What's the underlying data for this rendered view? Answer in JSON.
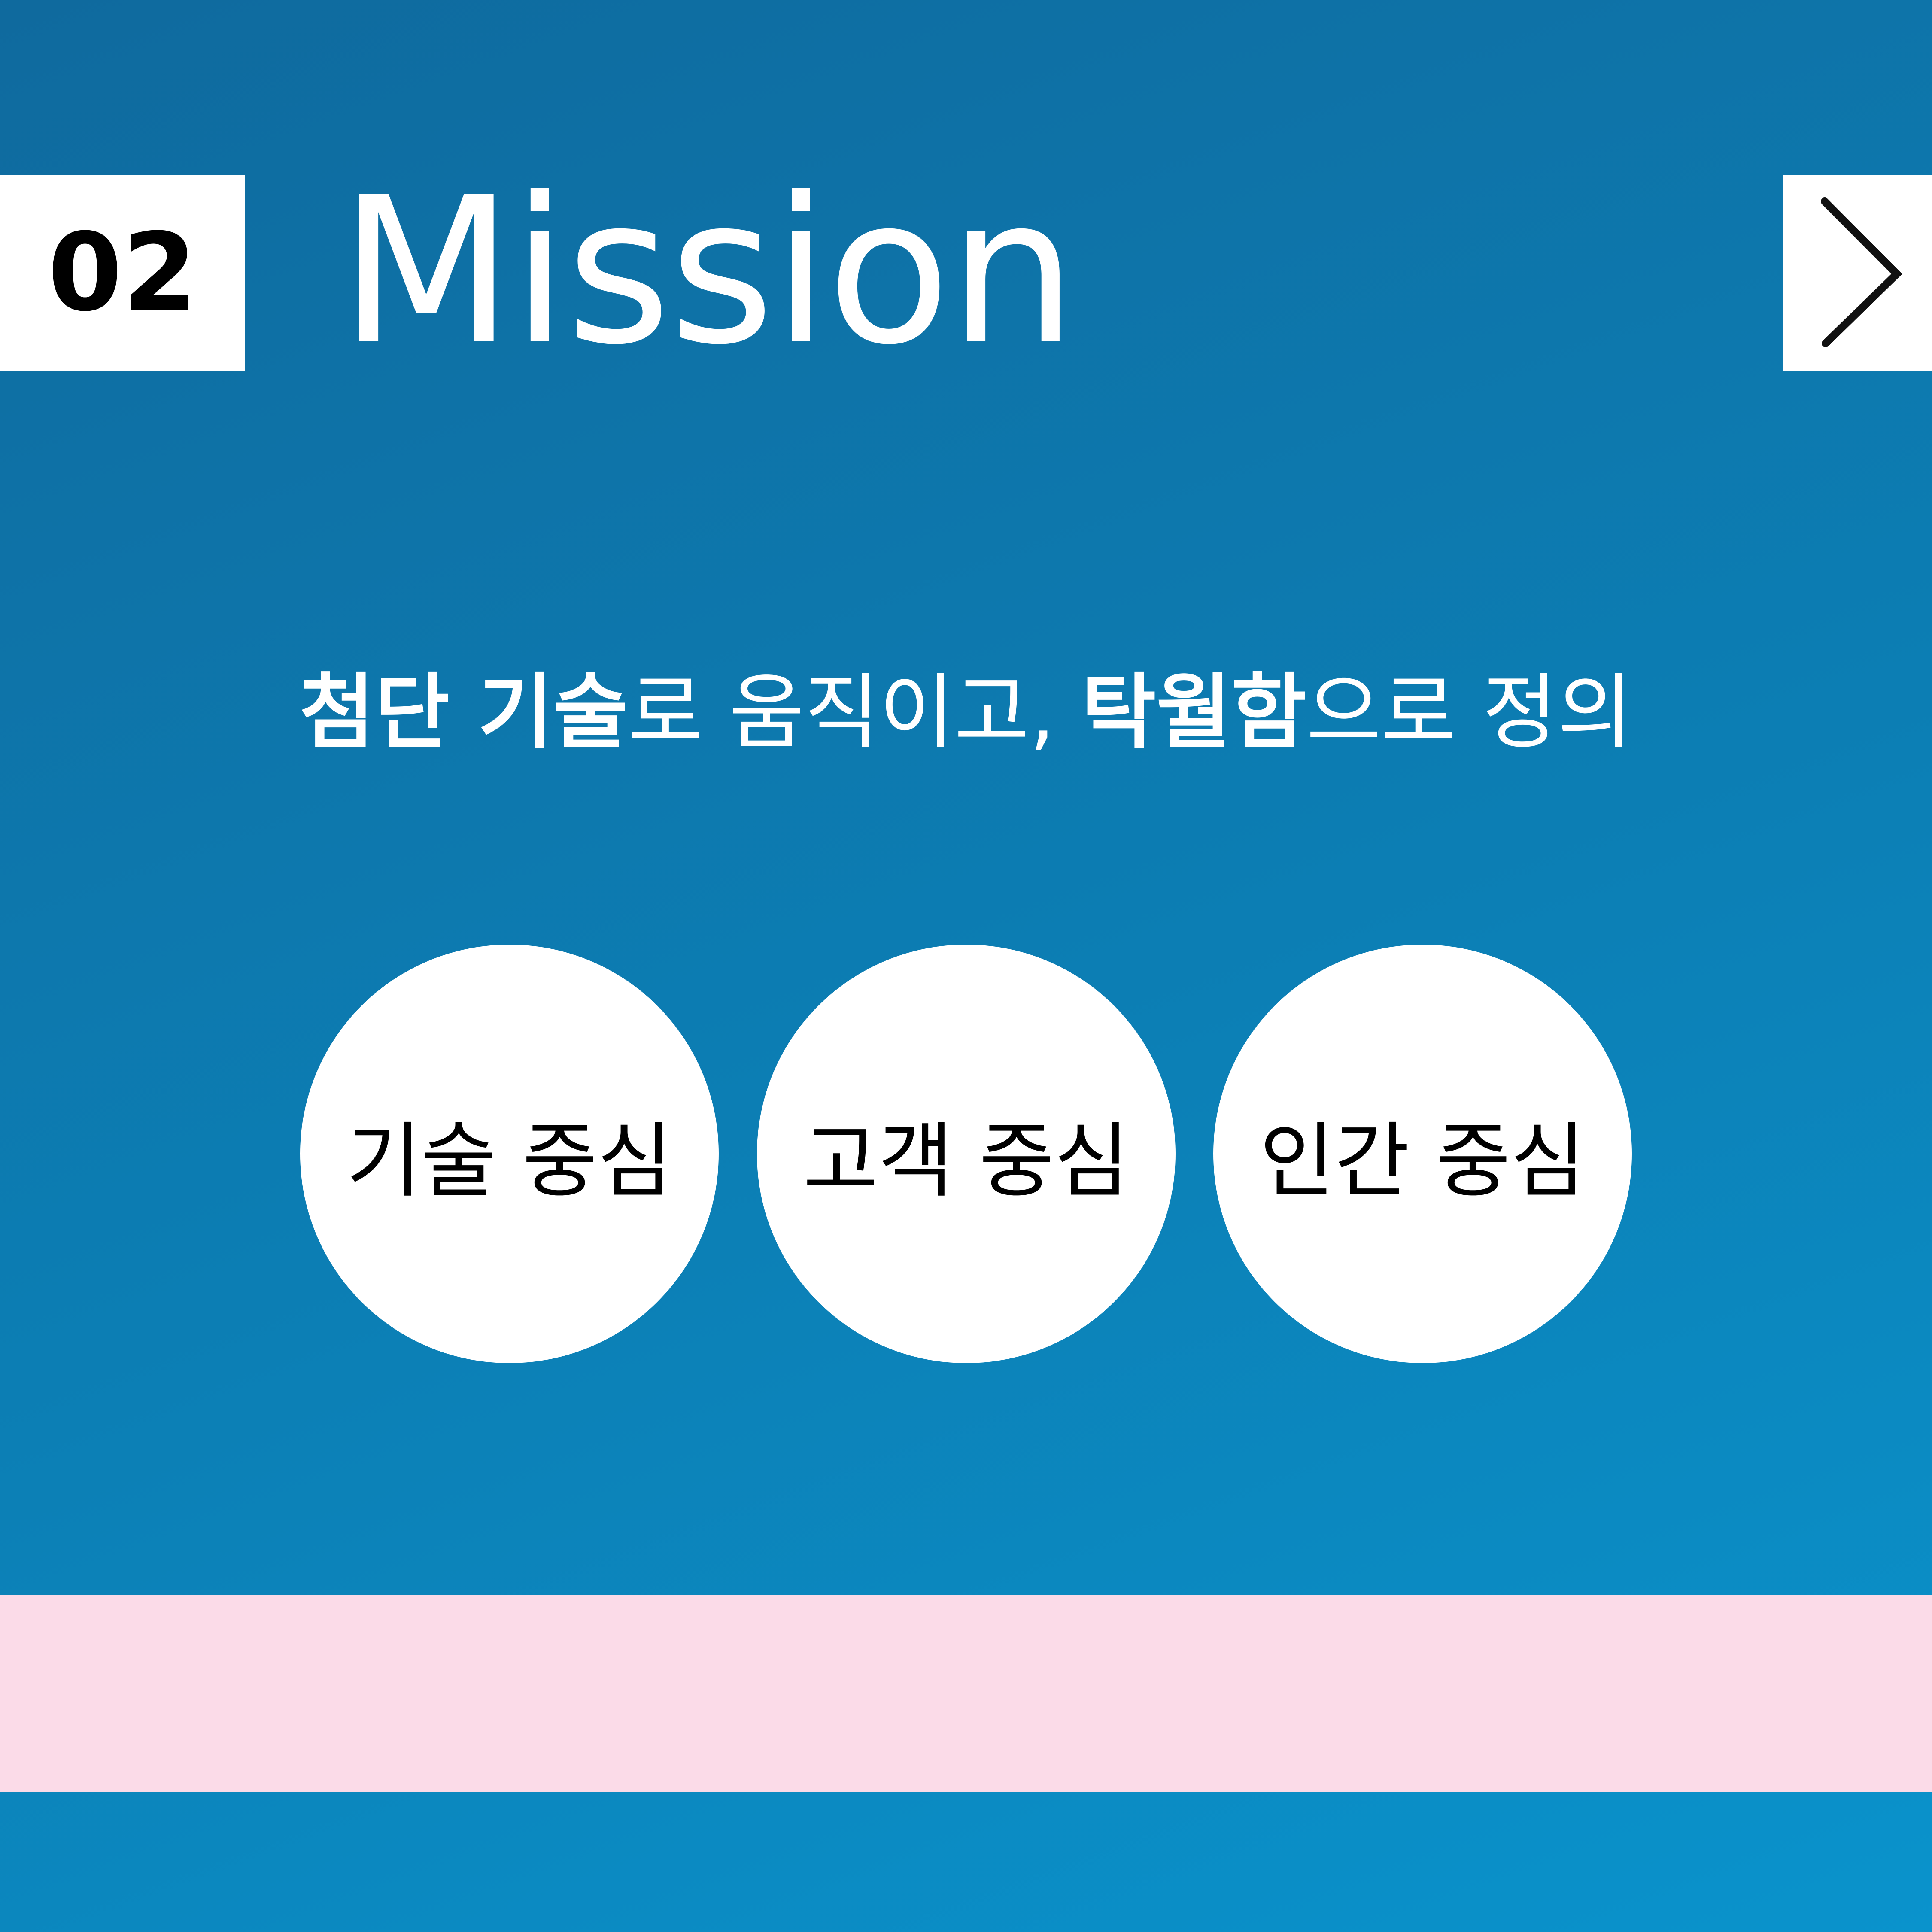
{
  "section": {
    "number": "02",
    "title": "Mission"
  },
  "nav": {
    "next_icon": "chevron-right-icon"
  },
  "subtitle": {
    "part1_bold": "첨단 기술",
    "part2": "로 움직이고, ",
    "part3_bold": "탁월함",
    "part4": "으로 정의"
  },
  "values": [
    {
      "label": "기술 중심"
    },
    {
      "label": "고객 중심"
    },
    {
      "label": "인간 중심"
    }
  ],
  "colors": {
    "background_top": "#0f6a9e",
    "background_bottom": "#0a93cc",
    "band": "#fbdbe8",
    "box": "#ffffff"
  }
}
